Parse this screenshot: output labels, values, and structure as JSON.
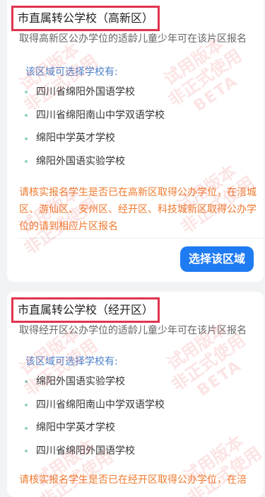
{
  "cards": [
    {
      "title": "市直属转公学校（高新区）",
      "subtitle": "取得高新区公办学位的适龄儿童少年可在该片区报名",
      "region_label": "该区域可选择学校有:",
      "schools": [
        "四川省绵阳外国语学校",
        "四川省绵阳南山中学双语学校",
        "绵阳中学英才学校",
        "绵阳外国语实验学校"
      ],
      "notice": "请核实报名学生是否已在高新区取得公办学位，在涪城区、游仙区、安州区、经开区、科技城新区取得公办学位的请到相应片区报名",
      "button": "选择该区域"
    },
    {
      "title": "市直属转公学校（经开区）",
      "subtitle": "取得经开区公办学位的适龄儿童少年可在该片区报名",
      "region_label": "该区域可选择学校有:",
      "schools": [
        "绵阳外国语实验学校",
        "四川省绵阳南山中学双语学校",
        "绵阳中学英才学校",
        "四川省绵阳外国语学校"
      ],
      "notice": "请核实报名学生是否已在经开区取得公办学位，在涪"
    }
  ],
  "watermark": {
    "line1": "试用版本",
    "line2": "非正式使用",
    "line3": "BETA"
  }
}
